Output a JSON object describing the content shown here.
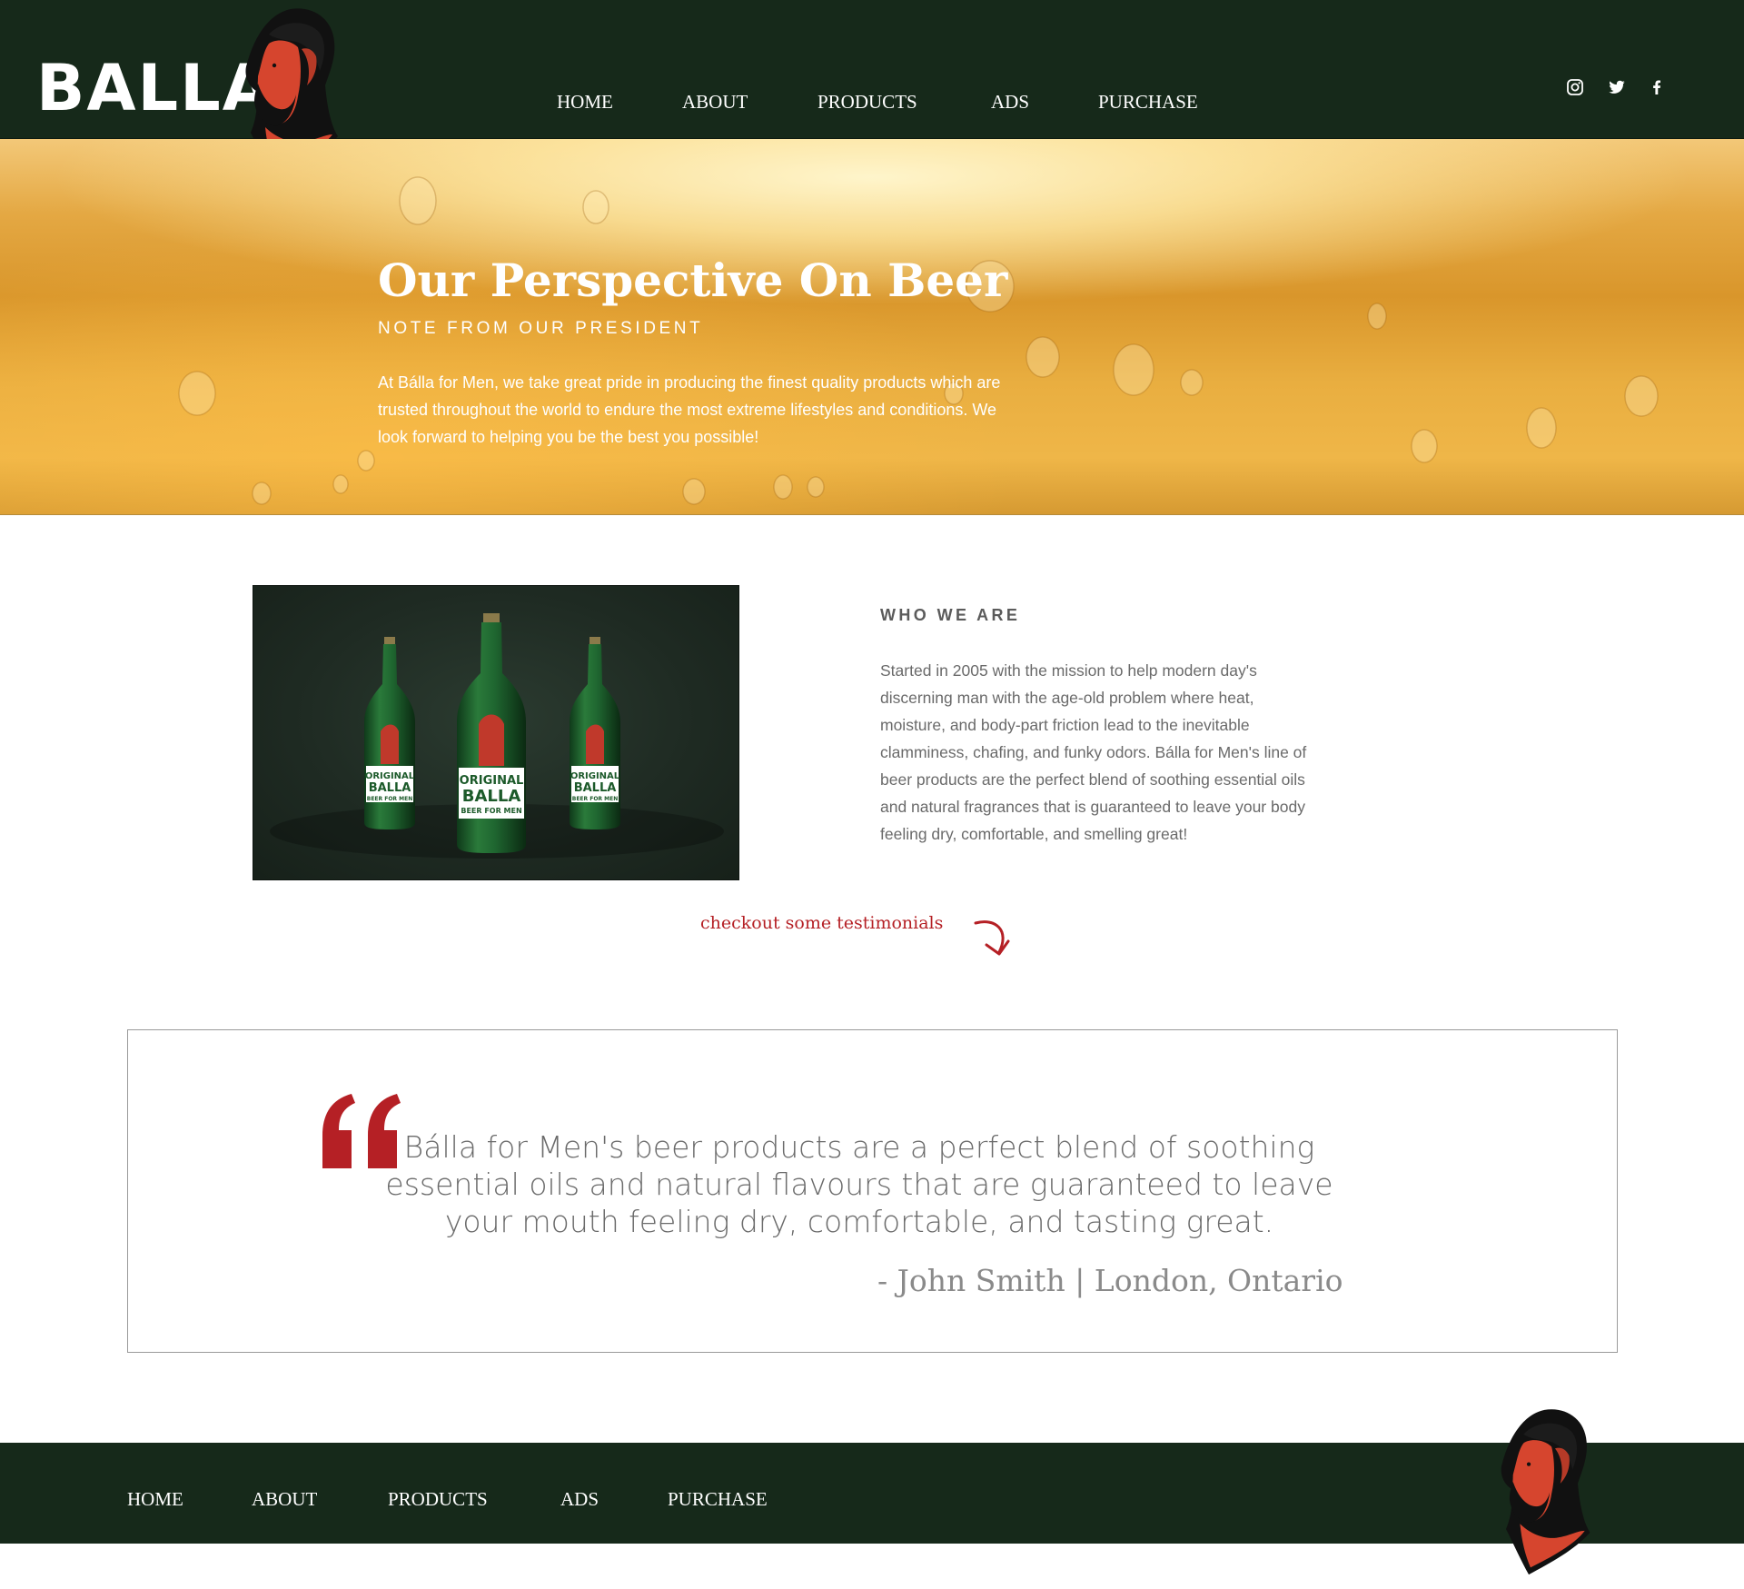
{
  "brand": {
    "name": "BALLA"
  },
  "nav": {
    "items": [
      "HOME",
      "ABOUT",
      "PRODUCTS",
      "ADS",
      "PURCHASE"
    ]
  },
  "social": [
    "instagram-icon",
    "twitter-icon",
    "facebook-icon"
  ],
  "hero": {
    "title": "Our Perspective On Beer",
    "subtitle": "NOTE FROM OUR PRESIDENT",
    "body": "At Bálla for Men, we take great pride in producing the finest quality products which are trusted throughout the world to endure the most extreme lifestyles and conditions. We look forward to helping you be the best you possible!"
  },
  "about": {
    "heading": "WHO WE ARE",
    "body": "Started in 2005 with the mission to help modern day's discerning man with the age-old problem where heat, moisture, and body-part friction lead to the inevitable clamminess, chafing, and funky odors. Bálla for Men's line of beer products are the perfect blend of soothing essential oils and natural fragrances that is guaranteed to leave your body feeling dry, comfortable, and smelling great!",
    "image": {
      "label_line1": "ORIGINAL",
      "label_line2": "BALLA",
      "label_line3": "BEER FOR MEN"
    }
  },
  "testimonials": {
    "link_text": "checkout some testimonials",
    "quote": "Bálla for Men's beer products are a perfect blend of soothing essential oils and natural flavours that are guaranteed to leave your mouth feeling dry, comfortable, and tasting great.",
    "author": "- John Smith | London, Ontario"
  },
  "colors": {
    "dark_green": "#16291a",
    "accent_red": "#b52025",
    "beer_amber": "#e4a843",
    "text_gray": "#6a6a6a"
  }
}
